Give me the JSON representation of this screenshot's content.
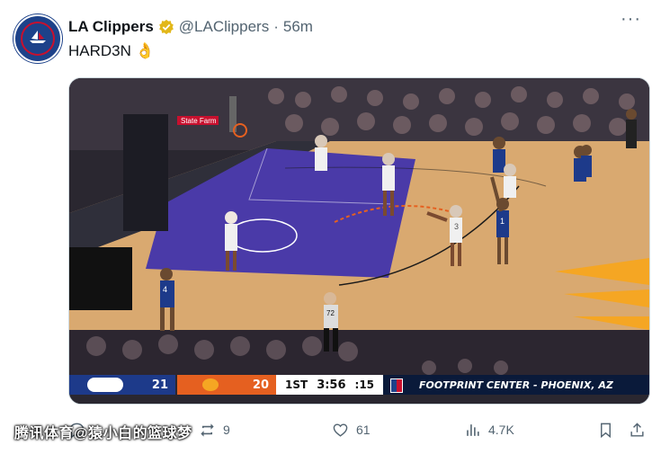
{
  "post": {
    "author_name": "LA Clippers",
    "verified_icon": "verified-badge-icon",
    "handle": "@LAClippers",
    "separator": "·",
    "time": "56m",
    "text": "HARD3N",
    "emoji": "👌",
    "more_icon": "more-icon"
  },
  "media": {
    "scoreboard": {
      "away_score": "21",
      "home_score": "20",
      "period": "1ST",
      "clock": "3:56",
      "shot_clock": ":15",
      "venue": "FOOTPRINT CENTER - PHOENIX, AZ"
    },
    "court_text": {
      "sponsor_statefarm": "State Farm",
      "jersey_a": "4",
      "jersey_b": "3",
      "jersey_c": "1",
      "ref_number": "72"
    },
    "colors": {
      "away": "#1d3a8a",
      "home": "#e56020",
      "paint": "#4a3aa8",
      "floor": "#d9a970"
    }
  },
  "actions": {
    "reply_count": "",
    "repost_count": "9",
    "like_count": "61",
    "views_count": "4.7K"
  },
  "watermark": "腾讯体育@猿小白的篮球梦"
}
